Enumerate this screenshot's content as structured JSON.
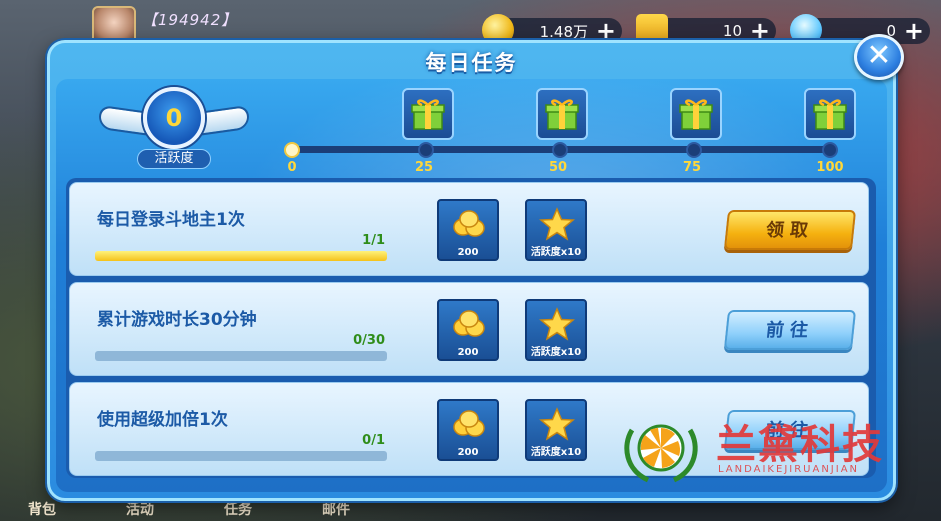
{
  "hud": {
    "player_id": "【194942】",
    "gold": "1.48万",
    "tickets": "10",
    "diamonds": "0",
    "plus": "+"
  },
  "bottom_nav": [
    "背包",
    "活动",
    "任务",
    "邮件"
  ],
  "dialog": {
    "title": "每日任务",
    "close_label": "✕",
    "activity": {
      "value": "0",
      "label": "活跃度"
    },
    "milestones": [
      {
        "label": "0"
      },
      {
        "label": "25"
      },
      {
        "label": "50"
      },
      {
        "label": "75"
      },
      {
        "label": "100"
      }
    ],
    "tasks": [
      {
        "name": "每日登录斗地主1次",
        "progress_text": "1/1",
        "progress": 1.0,
        "rewards": [
          {
            "icon": "gold-coins-icon",
            "label": "200"
          },
          {
            "icon": "star-icon",
            "label": "活跃度x10"
          }
        ],
        "action": "领取",
        "action_type": "claim"
      },
      {
        "name": "累计游戏时长30分钟",
        "progress_text": "0/30",
        "progress": 0.0,
        "rewards": [
          {
            "icon": "gold-coins-icon",
            "label": "200"
          },
          {
            "icon": "star-icon",
            "label": "活跃度x10"
          }
        ],
        "action": "前往",
        "action_type": "go"
      },
      {
        "name": "使用超级加倍1次",
        "progress_text": "0/1",
        "progress": 0.0,
        "rewards": [
          {
            "icon": "gold-coins-icon",
            "label": "200"
          },
          {
            "icon": "star-icon",
            "label": "活跃度x10"
          }
        ],
        "action": "前往",
        "action_type": "go"
      }
    ]
  },
  "watermark": {
    "text": "兰黛科技",
    "sub": "LANDAIKEJIRUANJIAN"
  },
  "colors": {
    "accent": "#2a8be0",
    "gold": "#ffd83a",
    "claim": "#f5b10f"
  }
}
